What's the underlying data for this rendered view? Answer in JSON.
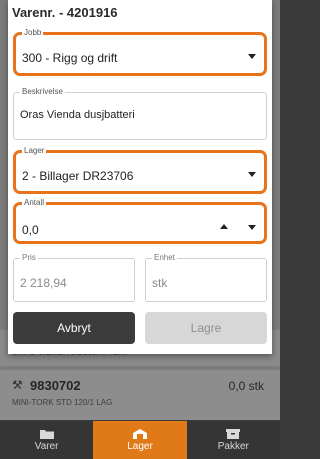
{
  "modal": {
    "title": "Varenr. - 4201916",
    "jobb": {
      "label": "Jobb",
      "value": "300 - Rigg og drift"
    },
    "beskrivelse": {
      "label": "Beskrivelse",
      "value": "Oras Vienda dusjbatteri"
    },
    "lager": {
      "label": "Lager",
      "value": "2 - Billager DR23706"
    },
    "antall": {
      "label": "Antall",
      "value": "0,0"
    },
    "pris": {
      "label": "Pris",
      "value": "2 218,94"
    },
    "enhet": {
      "label": "Enhet",
      "value": "stk"
    },
    "buttons": {
      "cancel": "Avbryt",
      "save": "Lagre"
    }
  },
  "background_list": {
    "row1_subtitle": "ORAS VIENDA DUSJBATTERI",
    "row2": {
      "code": "9830702",
      "qty": "0,0 stk",
      "subtitle": "MINI-TORK STD 120/1 LAG"
    }
  },
  "nav": {
    "items": [
      {
        "label": "Varer",
        "icon": "folder-icon",
        "active": false
      },
      {
        "label": "Lager",
        "icon": "warehouse-icon",
        "active": true
      },
      {
        "label": "Pakker",
        "icon": "package-icon",
        "active": false
      }
    ]
  },
  "colors": {
    "highlight": "#e8731a",
    "nav_active": "#e07a18",
    "cancel_button": "#3b3b3b",
    "save_button_disabled": "#d7d7d7"
  }
}
